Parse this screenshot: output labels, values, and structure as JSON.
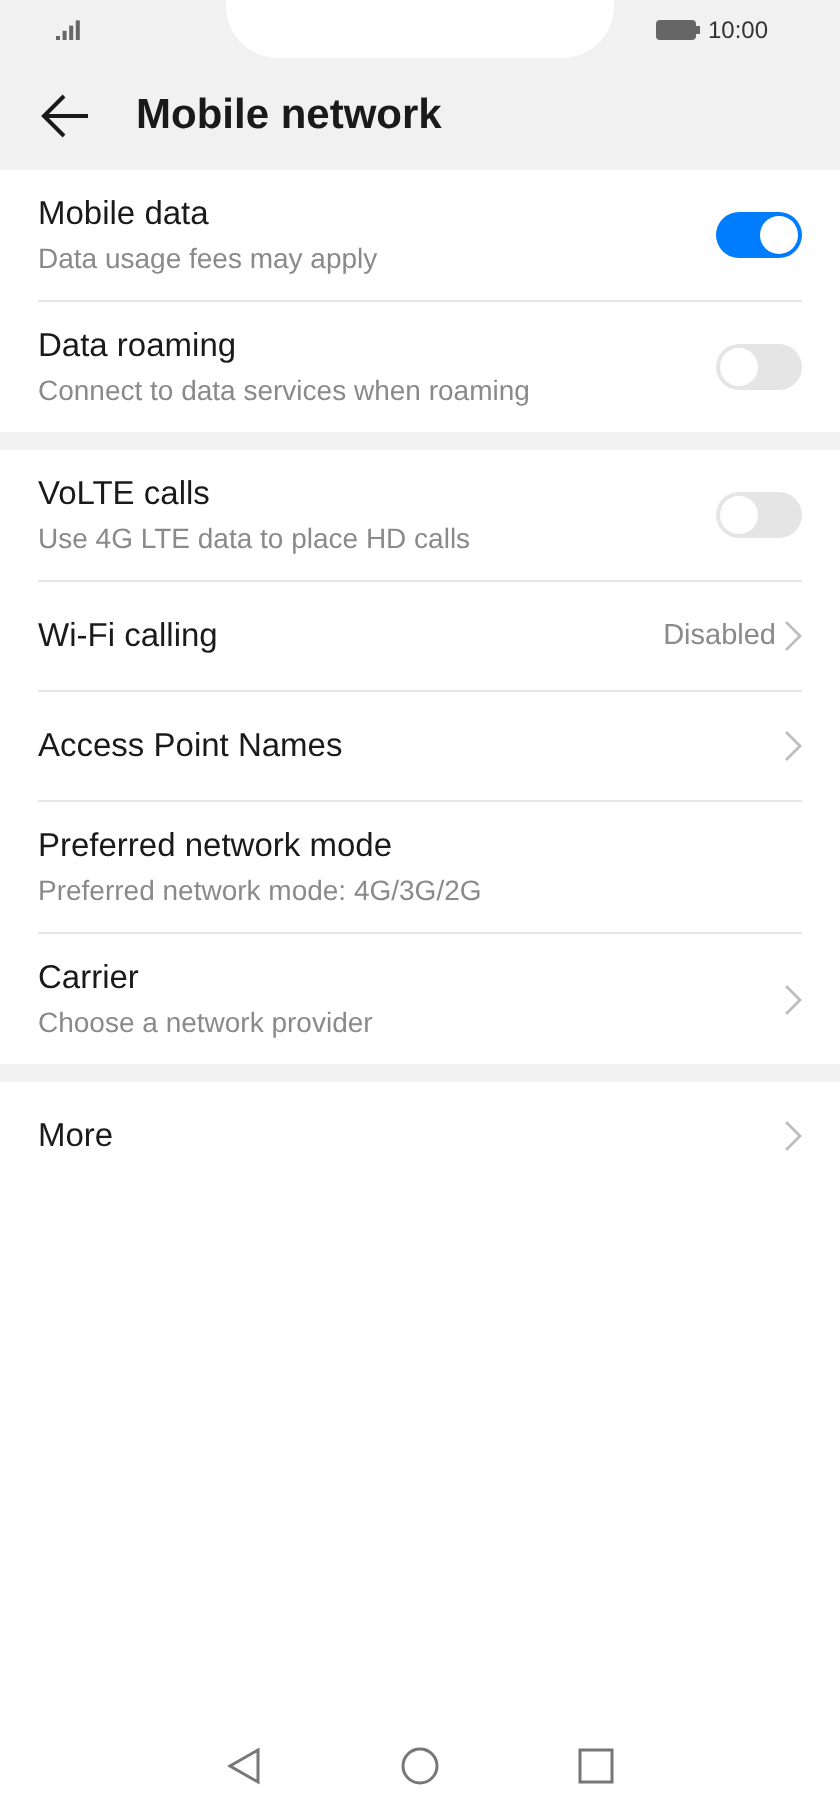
{
  "status_bar": {
    "time": "10:00"
  },
  "header": {
    "title": "Mobile network"
  },
  "sections": [
    {
      "rows": [
        {
          "kind": "toggle",
          "title": "Mobile data",
          "subtitle": "Data usage fees may apply",
          "on": true
        },
        {
          "kind": "toggle",
          "title": "Data roaming",
          "subtitle": "Connect to data services when roaming",
          "on": false
        }
      ]
    },
    {
      "rows": [
        {
          "kind": "toggle",
          "title": "VoLTE calls",
          "subtitle": "Use 4G LTE data to place HD calls",
          "on": false
        },
        {
          "kind": "link",
          "title": "Wi-Fi calling",
          "value": "Disabled"
        },
        {
          "kind": "link",
          "title": "Access Point Names"
        },
        {
          "kind": "plain",
          "title": "Preferred network mode",
          "subtitle": "Preferred network mode: 4G/3G/2G"
        },
        {
          "kind": "link",
          "title": "Carrier",
          "subtitle": "Choose a network provider"
        }
      ]
    },
    {
      "rows": [
        {
          "kind": "link",
          "title": "More"
        }
      ]
    }
  ]
}
